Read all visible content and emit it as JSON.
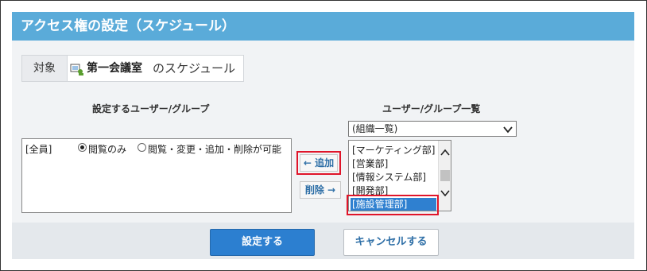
{
  "header": {
    "title": "アクセス権の設定（スケジュール）"
  },
  "target": {
    "label": "対象",
    "facility_name": "第一会議室",
    "suffix": "のスケジュール",
    "icon": "facility-icon"
  },
  "left": {
    "heading": "設定するユーザー/グループ",
    "entries": [
      {
        "member": "[全員]",
        "options": [
          "閲覧のみ",
          "閲覧・変更・追加・削除が可能"
        ],
        "selected": "閲覧のみ"
      }
    ]
  },
  "buttons": {
    "add": "← 追加",
    "remove": "削除 →"
  },
  "right": {
    "heading": "ユーザー/グループ一覧",
    "dropdown_value": "(組織一覧)",
    "options": [
      "[マーケティング部]",
      "[営業部]",
      "[情報システム部]",
      "[開発部]",
      "[施設管理部]"
    ],
    "selected": "[施設管理部]"
  },
  "footer": {
    "submit": "設定する",
    "cancel": "キャンセルする"
  },
  "colors": {
    "header_bg": "#5aabd9",
    "primary": "#2c7fd0",
    "highlight": "#e0152a",
    "selection": "#2f80d0"
  }
}
